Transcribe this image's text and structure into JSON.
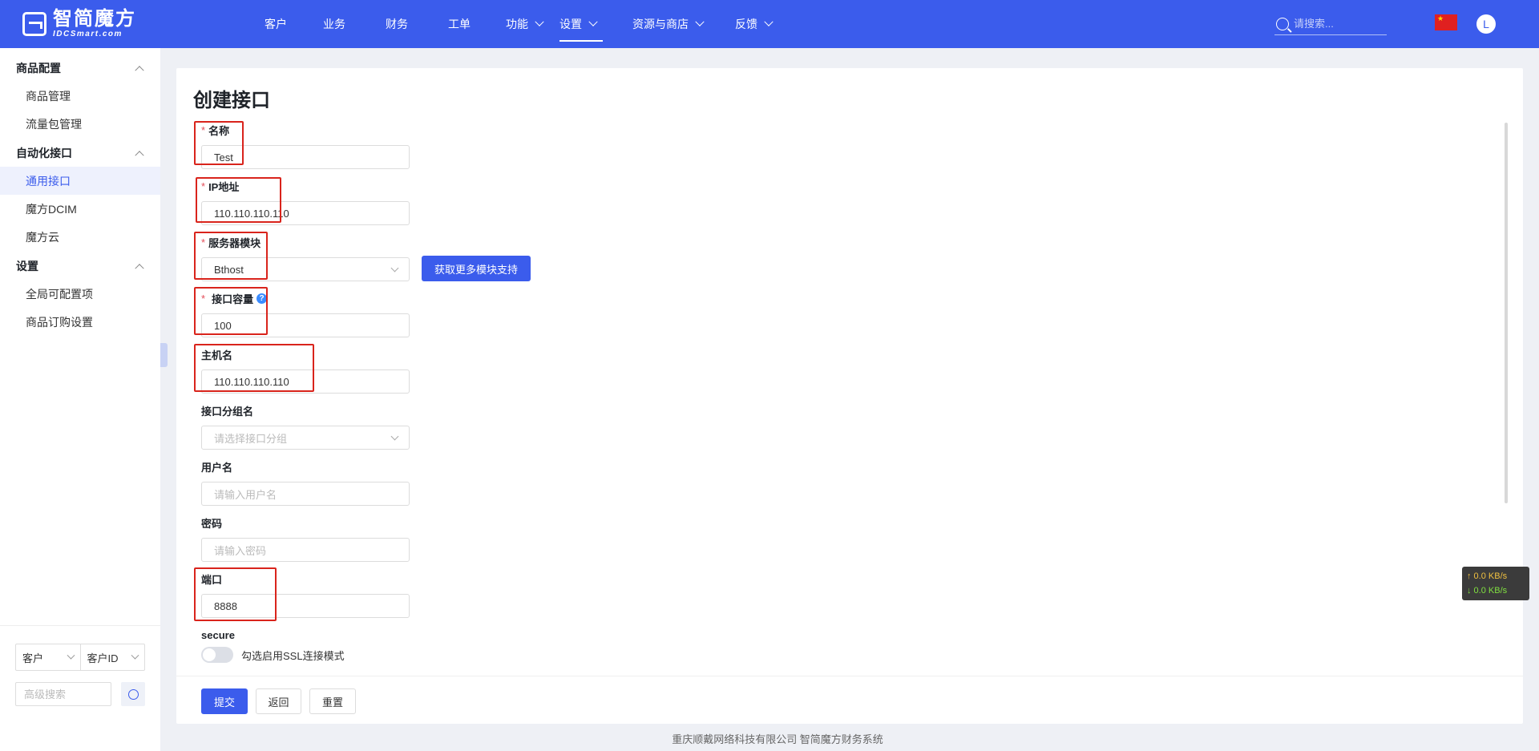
{
  "header": {
    "logo_cn": "智简魔方",
    "logo_en": "IDCSmart.com",
    "nav": [
      {
        "label": "客户",
        "dropdown": false,
        "active": false
      },
      {
        "label": "业务",
        "dropdown": false,
        "active": false
      },
      {
        "label": "财务",
        "dropdown": false,
        "active": false
      },
      {
        "label": "工单",
        "dropdown": false,
        "active": false
      },
      {
        "label": "功能",
        "dropdown": true,
        "active": false
      },
      {
        "label": "设置",
        "dropdown": true,
        "active": true
      },
      {
        "label": "资源与商店",
        "dropdown": true,
        "active": false
      },
      {
        "label": "反馈",
        "dropdown": true,
        "active": false
      }
    ],
    "search_placeholder": "请搜索...",
    "avatar_letter": "L",
    "accent": "#3b5cec"
  },
  "sidebar": {
    "groups": [
      {
        "title": "商品配置",
        "items": [
          {
            "label": "商品管理",
            "active": false
          },
          {
            "label": "流量包管理",
            "active": false
          }
        ]
      },
      {
        "title": "自动化接口",
        "items": [
          {
            "label": "通用接口",
            "active": true
          },
          {
            "label": "魔方DCIM",
            "active": false
          },
          {
            "label": "魔方云",
            "active": false
          }
        ]
      },
      {
        "title": "设置",
        "items": [
          {
            "label": "全局可配置项",
            "active": false
          },
          {
            "label": "商品订购设置",
            "active": false
          }
        ]
      }
    ],
    "filter_type": "客户",
    "filter_field": "客户ID",
    "advanced_search_placeholder": "高级搜索"
  },
  "page": {
    "title": "创建接口",
    "fields": {
      "name": {
        "label": "名称",
        "required": true,
        "value": "Test"
      },
      "ip": {
        "label": "IP地址",
        "required": true,
        "value": "110.110.110.110"
      },
      "module": {
        "label": "服务器模块",
        "required": true,
        "value": "Bthost"
      },
      "capacity": {
        "label": "接口容量",
        "required": true,
        "value": "100"
      },
      "hostname": {
        "label": "主机名",
        "required": false,
        "value": "110.110.110.110"
      },
      "group": {
        "label": "接口分组名",
        "required": false,
        "placeholder": "请选择接口分组"
      },
      "username": {
        "label": "用户名",
        "required": false,
        "placeholder": "请输入用户名"
      },
      "password": {
        "label": "密码",
        "required": false,
        "placeholder": "请输入密码"
      },
      "port": {
        "label": "端口",
        "required": false,
        "value": "8888"
      },
      "secure": {
        "label": "secure",
        "toggle_text": "勾选启用SSL连接模式",
        "enabled": false
      }
    },
    "fetch_module_button": "获取更多模块支持",
    "submit_button": "提交",
    "back_button": "返回",
    "reset_button": "重置"
  },
  "footer": {
    "copyright": "重庆顺戴网络科技有限公司 智简魔方财务系统"
  },
  "speed_widget": {
    "upload": "↑ 0.0 KB/s",
    "download": "↓ 0.0 KB/s"
  }
}
